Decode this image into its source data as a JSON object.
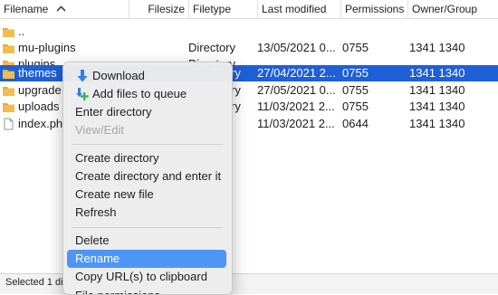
{
  "columns": {
    "filename": "Filename",
    "filesize": "Filesize",
    "filetype": "Filetype",
    "last_modified": "Last modified",
    "permissions": "Permissions",
    "owner_group": "Owner/Group"
  },
  "rows": [
    {
      "name": "..",
      "type": "",
      "modified": "",
      "perms": "",
      "owner": "",
      "icon": "folder-icon"
    },
    {
      "name": "mu-plugins",
      "type": "Directory",
      "modified": "13/05/2021 0...",
      "perms": "0755",
      "owner": "1341 1340",
      "icon": "folder-icon"
    },
    {
      "name": "plugins",
      "type": "Directory",
      "modified": "",
      "perms": "",
      "owner": "",
      "icon": "folder-icon"
    },
    {
      "name": "themes",
      "type": "ry",
      "modified": "27/04/2021 2...",
      "perms": "0755",
      "owner": "1341 1340",
      "icon": "folder-icon"
    },
    {
      "name": "upgrade",
      "type": "ry",
      "modified": "27/05/2021 0...",
      "perms": "0755",
      "owner": "1341 1340",
      "icon": "folder-icon"
    },
    {
      "name": "uploads",
      "type": "ry",
      "modified": "11/03/2021 2...",
      "perms": "0755",
      "owner": "1341 1340",
      "icon": "folder-icon"
    },
    {
      "name": "index.ph",
      "type": "",
      "modified": "11/03/2021 2...",
      "perms": "0644",
      "owner": "1341 1340",
      "icon": "file-icon"
    }
  ],
  "context_menu": {
    "download": "Download",
    "add_to_queue": "Add files to queue",
    "enter_directory": "Enter directory",
    "view_edit": "View/Edit",
    "create_directory": "Create directory",
    "create_directory_enter": "Create directory and enter it",
    "create_new_file": "Create new file",
    "refresh": "Refresh",
    "delete": "Delete",
    "rename": "Rename",
    "copy_urls": "Copy URL(s) to clipboard",
    "file_permissions": "File permissions..."
  },
  "status_bar": {
    "text": "Selected 1 di"
  },
  "colors": {
    "selection": "#1f5fd7",
    "menu_highlight": "#4e96f6",
    "folder": "#e8a83a",
    "download_arrow": "#2f7fe8",
    "add_plus": "#35b35a"
  }
}
